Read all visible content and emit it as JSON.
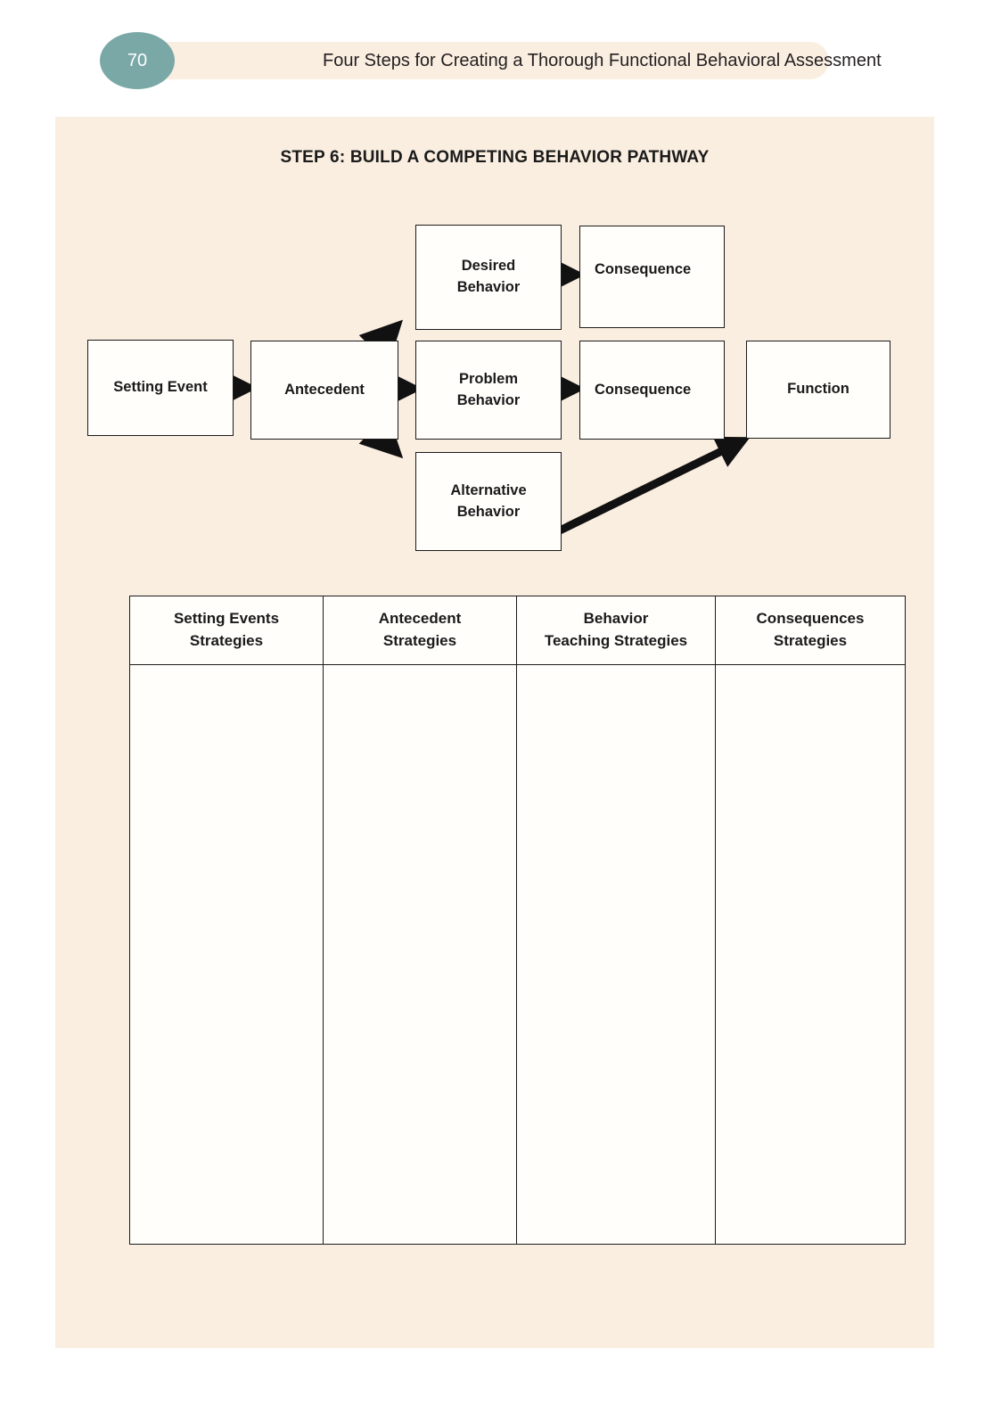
{
  "header": {
    "page_number": "70",
    "title": "Four Steps for Creating a Thorough Functional Behavioral Assessment",
    "badge_color": "#7aa8a6",
    "bar_color": "#faeee1"
  },
  "worksheet": {
    "title": "STEP 6: BUILD A COMPETING BEHAVIOR PATHWAY",
    "panel_color": "#faeee1"
  },
  "diagram": {
    "nodes": {
      "setting_event": "Setting Event",
      "antecedent": "Antecedent",
      "desired_behavior": "Desired\nBehavior",
      "desired_behavior_line1": "Desired",
      "desired_behavior_line2": "Behavior",
      "problem_behavior_line1": "Problem",
      "problem_behavior_line2": "Behavior",
      "alternative_behavior_line1": "Alternative",
      "alternative_behavior_line2": "Behavior",
      "consequence_desired": "Consequence",
      "consequence_problem": "Consequence",
      "function": "Function"
    },
    "connections": [
      {
        "from": "setting_event",
        "to": "antecedent",
        "style": "straight-right"
      },
      {
        "from": "antecedent",
        "to": "desired_behavior",
        "style": "diagonal-up-right"
      },
      {
        "from": "antecedent",
        "to": "problem_behavior",
        "style": "straight-right"
      },
      {
        "from": "antecedent",
        "to": "alternative_behavior",
        "style": "diagonal-down-right"
      },
      {
        "from": "desired_behavior",
        "to": "consequence_desired",
        "style": "straight-right"
      },
      {
        "from": "problem_behavior",
        "to": "consequence_problem",
        "style": "straight-right"
      },
      {
        "from": "alternative_behavior",
        "to": "function",
        "style": "long-diagonal-up-right"
      }
    ],
    "line_color": "#111111",
    "box_fill": "#fffefb"
  },
  "table": {
    "columns": [
      {
        "line1": "Setting Events",
        "line2": "Strategies"
      },
      {
        "line1": "Antecedent",
        "line2": "Strategies"
      },
      {
        "line1": "Behavior",
        "line2": "Teaching Strategies"
      },
      {
        "line1": "Consequences",
        "line2": "Strategies"
      }
    ],
    "rows": [
      [
        "",
        "",
        "",
        ""
      ]
    ]
  }
}
